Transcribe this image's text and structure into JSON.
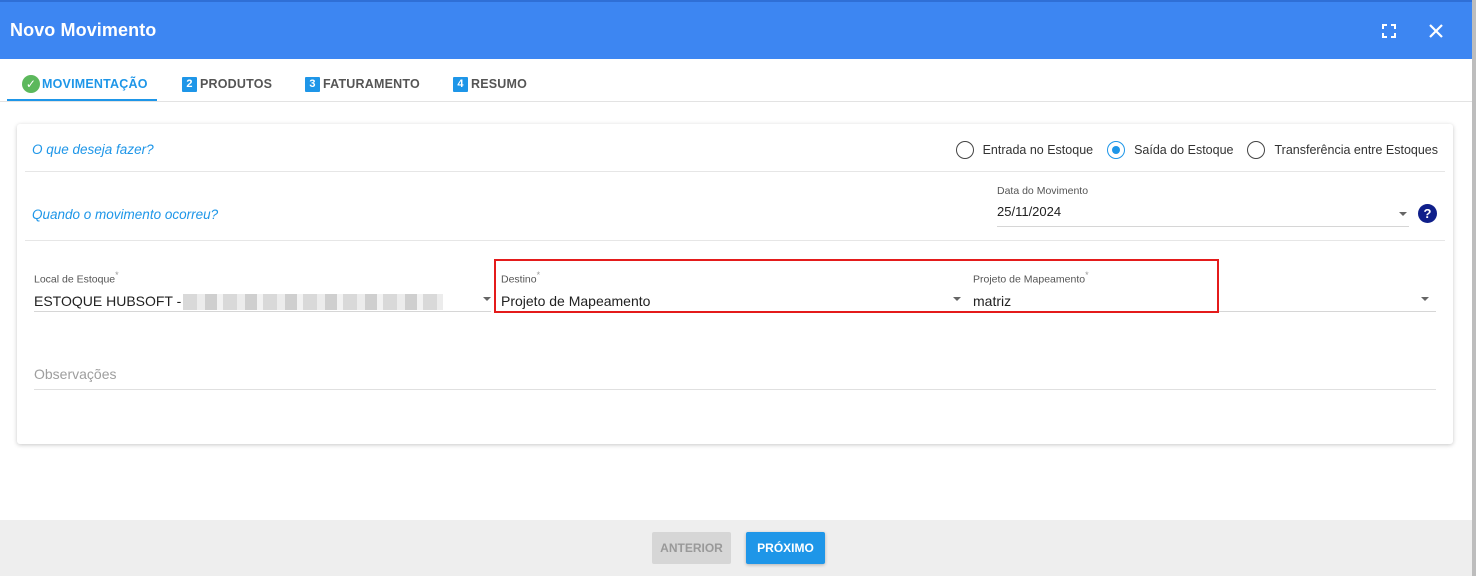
{
  "header": {
    "title": "Novo Movimento"
  },
  "tabs": [
    {
      "label": "MOVIMENTAÇÃO",
      "step": "",
      "done": true
    },
    {
      "label": "PRODUTOS",
      "step": "2"
    },
    {
      "label": "FATURAMENTO",
      "step": "3"
    },
    {
      "label": "RESUMO",
      "step": "4"
    }
  ],
  "form": {
    "question_what": "O que deseja fazer?",
    "radios": [
      {
        "label": "Entrada no Estoque",
        "selected": false
      },
      {
        "label": "Saída do Estoque",
        "selected": true
      },
      {
        "label": "Transferência entre Estoques",
        "selected": false
      }
    ],
    "question_when": "Quando o movimento ocorreu?",
    "date": {
      "label": "Data do Movimento",
      "value": "25/11/2024"
    },
    "local": {
      "label": "Local de Estoque",
      "required": "*",
      "value": "ESTOQUE HUBSOFT -"
    },
    "destino": {
      "label": "Destino",
      "required": "*",
      "value": "Projeto de Mapeamento"
    },
    "projeto": {
      "label": "Projeto de Mapeamento",
      "required": "*",
      "value": "matriz"
    },
    "observacoes": {
      "placeholder": "Observações"
    }
  },
  "footer": {
    "prev_label": "ANTERIOR",
    "next_label": "PRÓXIMO"
  },
  "colors": {
    "header": "#3d86f2",
    "accent": "#1e96e8",
    "highlight": "#e41b1b",
    "success": "#5cb85c"
  }
}
